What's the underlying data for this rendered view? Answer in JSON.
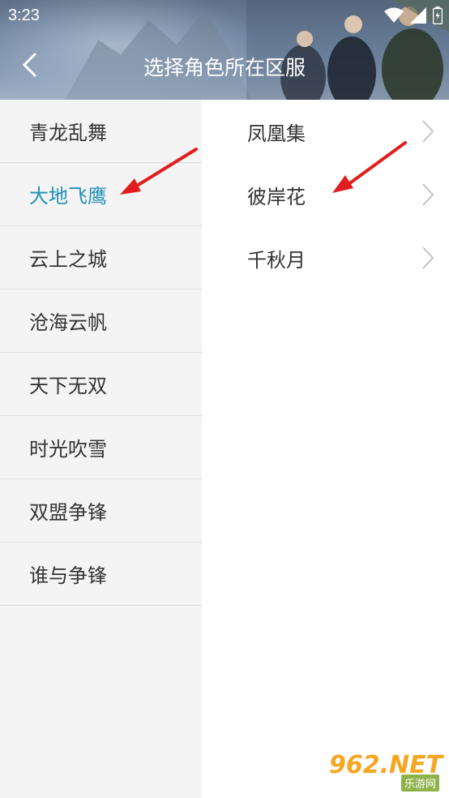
{
  "status_bar": {
    "time": "3:23"
  },
  "header": {
    "title": "选择角色所在区服"
  },
  "left_list": [
    {
      "label": "青龙乱舞",
      "active": false
    },
    {
      "label": "大地飞鹰",
      "active": true
    },
    {
      "label": "云上之城",
      "active": false
    },
    {
      "label": "沧海云帆",
      "active": false
    },
    {
      "label": "天下无双",
      "active": false
    },
    {
      "label": "时光吹雪",
      "active": false
    },
    {
      "label": "双盟争锋",
      "active": false
    },
    {
      "label": "谁与争锋",
      "active": false
    }
  ],
  "right_list": [
    {
      "label": "凤凰集"
    },
    {
      "label": "彼岸花"
    },
    {
      "label": "千秋月"
    }
  ],
  "colors": {
    "active_text": "#1f8fb9",
    "annotation_arrow": "#e01e1e"
  },
  "watermark": {
    "main": "962.NET",
    "sub": "乐游网"
  }
}
